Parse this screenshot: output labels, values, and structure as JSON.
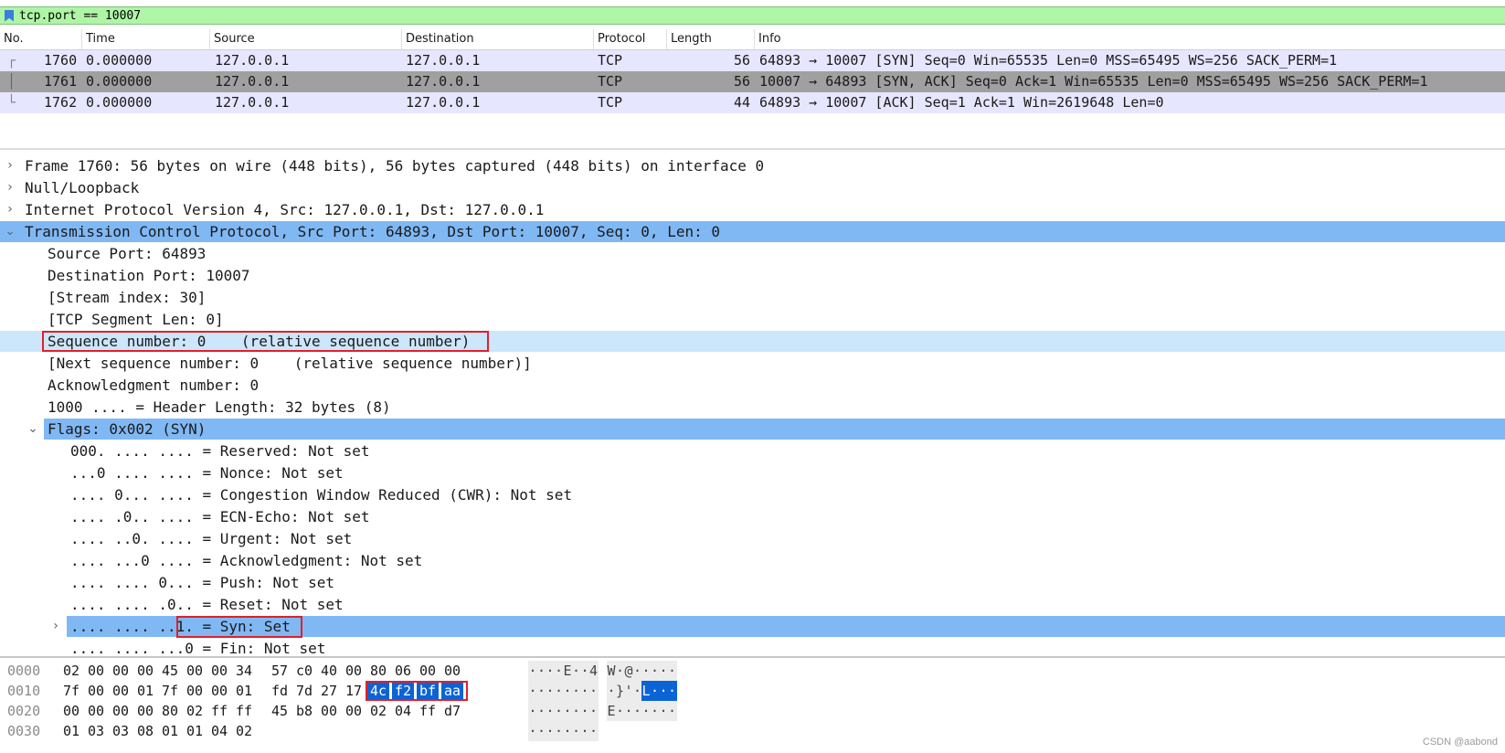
{
  "display_filter": {
    "value": "tcp.port == 10007",
    "icon": "bookmark-icon"
  },
  "packet_list": {
    "columns": [
      "No.",
      "Time",
      "Source",
      "Destination",
      "Protocol",
      "Length",
      "Info"
    ],
    "rows": [
      {
        "no": "1760",
        "time": "0.000000",
        "source": "127.0.0.1",
        "destination": "127.0.0.1",
        "protocol": "TCP",
        "length": "56",
        "info": "64893 → 10007 [SYN] Seq=0 Win=65535 Len=0 MSS=65495 WS=256 SACK_PERM=1"
      },
      {
        "no": "1761",
        "time": "0.000000",
        "source": "127.0.0.1",
        "destination": "127.0.0.1",
        "protocol": "TCP",
        "length": "56",
        "info": "10007 → 64893 [SYN, ACK] Seq=0 Ack=1 Win=65535 Len=0 MSS=65495 WS=256 SACK_PERM=1"
      },
      {
        "no": "1762",
        "time": "0.000000",
        "source": "127.0.0.1",
        "destination": "127.0.0.1",
        "protocol": "TCP",
        "length": "44",
        "info": "64893 → 10007 [ACK] Seq=1 Ack=1 Win=2619648 Len=0"
      }
    ]
  },
  "details": {
    "rows": [
      {
        "text": "Frame 1760: 56 bytes on wire (448 bits), 56 bytes captured (448 bits) on interface 0",
        "expander": "collapsed"
      },
      {
        "text": "Null/Loopback",
        "expander": "collapsed"
      },
      {
        "text": "Internet Protocol Version 4, Src: 127.0.0.1, Dst: 127.0.0.1",
        "expander": "collapsed"
      },
      {
        "text": "Transmission Control Protocol, Src Port: 64893, Dst Port: 10007, Seq: 0, Len: 0",
        "expander": "expanded",
        "state": "selected"
      },
      {
        "text": "Source Port: 64893"
      },
      {
        "text": "Destination Port: 10007"
      },
      {
        "text": "[Stream index: 30]"
      },
      {
        "text": "[TCP Segment Len: 0]"
      },
      {
        "text": "Sequence number: 0    (relative sequence number)",
        "state": "highlighted"
      },
      {
        "text": "[Next sequence number: 0    (relative sequence number)]"
      },
      {
        "text": "Acknowledgment number: 0"
      },
      {
        "text": "1000 .... = Header Length: 32 bytes (8)"
      },
      {
        "text": "Flags: 0x002 (SYN)",
        "expander": "expanded",
        "state": "selected"
      },
      {
        "text": "000. .... .... = Reserved: Not set"
      },
      {
        "text": "...0 .... .... = Nonce: Not set"
      },
      {
        "text": ".... 0... .... = Congestion Window Reduced (CWR): Not set"
      },
      {
        "text": ".... .0.. .... = ECN-Echo: Not set"
      },
      {
        "text": ".... ..0. .... = Urgent: Not set"
      },
      {
        "text": ".... ...0 .... = Acknowledgment: Not set"
      },
      {
        "text": ".... .... 0... = Push: Not set"
      },
      {
        "text": ".... .... .0.. = Reset: Not set"
      },
      {
        "text": ".... .... ..1. = Syn: Set",
        "expander": "collapsed",
        "state": "selected"
      },
      {
        "text": ".... .... ...0 = Fin: Not set"
      }
    ]
  },
  "hex": {
    "rows": [
      {
        "offset": "0000",
        "bytes": [
          "02",
          "00",
          "00",
          "00",
          "45",
          "00",
          "00",
          "34",
          "57",
          "c0",
          "40",
          "00",
          "80",
          "06",
          "00",
          "00"
        ],
        "ascii": [
          "·",
          "·",
          "·",
          "·",
          "E",
          "·",
          "·",
          "4",
          "W",
          "·",
          "@",
          "·",
          "·",
          "·",
          "·",
          "·"
        ]
      },
      {
        "offset": "0010",
        "bytes": [
          "7f",
          "00",
          "00",
          "01",
          "7f",
          "00",
          "00",
          "01",
          "fd",
          "7d",
          "27",
          "17",
          "4c",
          "f2",
          "bf",
          "aa"
        ],
        "ascii": [
          "·",
          "·",
          "·",
          "·",
          "·",
          "·",
          "·",
          "·",
          "·",
          "}",
          "'",
          "·",
          "L",
          "·",
          "·",
          "·"
        ]
      },
      {
        "offset": "0020",
        "bytes": [
          "00",
          "00",
          "00",
          "00",
          "80",
          "02",
          "ff",
          "ff",
          "45",
          "b8",
          "00",
          "00",
          "02",
          "04",
          "ff",
          "d7"
        ],
        "ascii": [
          "·",
          "·",
          "·",
          "·",
          "·",
          "·",
          "·",
          "·",
          "E",
          "·",
          "·",
          "·",
          "·",
          "·",
          "·",
          "·"
        ]
      },
      {
        "offset": "0030",
        "bytes": [
          "01",
          "03",
          "03",
          "08",
          "01",
          "01",
          "04",
          "02"
        ],
        "ascii": [
          "·",
          "·",
          "·",
          "·",
          "·",
          "·",
          "·",
          "·"
        ]
      }
    ],
    "selected_bytes": "4c f2 bf aa"
  },
  "watermark": "CSDN @aabond",
  "colors": {
    "filter_ok": "#aff5a6",
    "selected_row": "#80b8f4",
    "highlight_row": "#cce6fb",
    "marked_row": "#a0a0a0",
    "tcp_row": "#e7e6ff",
    "annotation_box": "#e0202a",
    "byte_selection": "#0a64d6"
  }
}
